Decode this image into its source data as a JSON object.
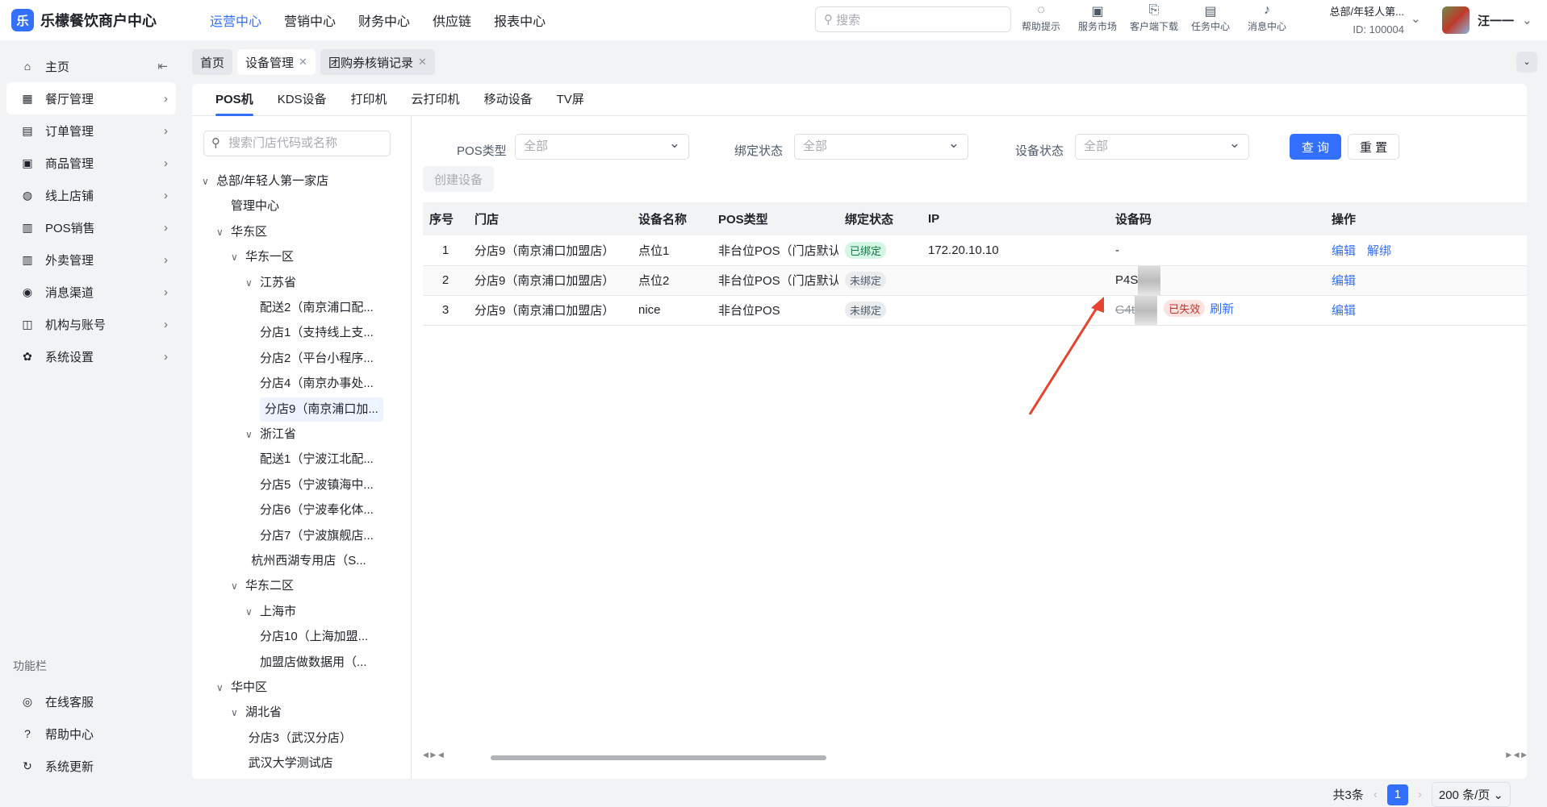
{
  "app": {
    "title": "乐檬餐饮商户中心",
    "logo_letter": "乐"
  },
  "nav": [
    "运营中心",
    "营销中心",
    "财务中心",
    "供应链",
    "报表中心"
  ],
  "search": {
    "placeholder": "搜索"
  },
  "tools": [
    {
      "icon": "lightbulb",
      "label": "帮助提示"
    },
    {
      "icon": "store-bag",
      "label": "服务市场"
    },
    {
      "icon": "download",
      "label": "客户端下载"
    },
    {
      "icon": "clipboard",
      "label": "任务中心"
    },
    {
      "icon": "bell",
      "label": "消息中心"
    }
  ],
  "org": {
    "name": "总部/年轻人第...",
    "id": "ID: 100004"
  },
  "user": {
    "name": "汪一一"
  },
  "sidebar": {
    "items": [
      {
        "icon": "⌂",
        "label": "主页"
      },
      {
        "icon": "▦",
        "label": "餐厅管理"
      },
      {
        "icon": "▤",
        "label": "订单管理"
      },
      {
        "icon": "▣",
        "label": "商品管理"
      },
      {
        "icon": "◍",
        "label": "线上店铺"
      },
      {
        "icon": "▥",
        "label": "POS销售"
      },
      {
        "icon": "▥",
        "label": "外卖管理"
      },
      {
        "icon": "◉",
        "label": "消息渠道"
      },
      {
        "icon": "◫",
        "label": "机构与账号"
      },
      {
        "icon": "✿",
        "label": "系统设置"
      }
    ],
    "func_label": "功能栏",
    "bottom": [
      {
        "icon": "◎",
        "label": "在线客服"
      },
      {
        "icon": "?",
        "label": "帮助中心"
      },
      {
        "icon": "↻",
        "label": "系统更新"
      }
    ]
  },
  "tabs": [
    {
      "label": "首页"
    },
    {
      "label": "设备管理"
    },
    {
      "label": "团购券核销记录"
    }
  ],
  "subtabs": [
    "POS机",
    "KDS设备",
    "打印机",
    "云打印机",
    "移动设备",
    "TV屏"
  ],
  "tree": {
    "search_placeholder": "搜索门店代码或名称",
    "nodes": [
      {
        "label": "总部/年轻人第一家店",
        "lvl": 0,
        "arrow": true
      },
      {
        "label": "管理中心",
        "lvl": 1,
        "arrow": false
      },
      {
        "label": "华东区",
        "lvl": 1,
        "arrow": true
      },
      {
        "label": "华东一区",
        "lvl": 2,
        "arrow": true
      },
      {
        "label": "江苏省",
        "lvl": 3,
        "arrow": true
      },
      {
        "label": "配送2（南京浦口配...",
        "lvl": 4
      },
      {
        "label": "分店1（支持线上支...",
        "lvl": 4
      },
      {
        "label": "分店2（平台小程序...",
        "lvl": 4
      },
      {
        "label": "分店4（南京办事处...",
        "lvl": 4
      },
      {
        "label": "分店9（南京浦口加...",
        "lvl": 4,
        "selected": true
      },
      {
        "label": "浙江省",
        "lvl": 3,
        "arrow": true
      },
      {
        "label": "配送1（宁波江北配...",
        "lvl": 4
      },
      {
        "label": "分店5（宁波镇海中...",
        "lvl": 4
      },
      {
        "label": "分店6（宁波奉化体...",
        "lvl": 4
      },
      {
        "label": "分店7（宁波旗舰店...",
        "lvl": 4
      },
      {
        "label": "杭州西湖专用店（S...",
        "lvl": 3.4
      },
      {
        "label": "华东二区",
        "lvl": 2,
        "arrow": true
      },
      {
        "label": "上海市",
        "lvl": 3,
        "arrow": true
      },
      {
        "label": "分店10（上海加盟...",
        "lvl": 4
      },
      {
        "label": "加盟店做数据用（...",
        "lvl": 4
      },
      {
        "label": "华中区",
        "lvl": 1,
        "arrow": true
      },
      {
        "label": "湖北省",
        "lvl": 2,
        "arrow": true
      },
      {
        "label": "分店3（武汉分店）",
        "lvl": 3.2
      },
      {
        "label": "武汉大学测试店",
        "lvl": 3.2
      }
    ]
  },
  "filters": {
    "pos_type_label": "POS类型",
    "pos_type_value": "全部",
    "bind_label": "绑定状态",
    "bind_value": "全部",
    "status_label": "设备状态",
    "status_value": "全部",
    "query": "查 询",
    "reset": "重 置",
    "create": "创建设备"
  },
  "table": {
    "headers": [
      "序号",
      "门店",
      "设备名称",
      "POS类型",
      "绑定状态",
      "IP",
      "设备码",
      "操作"
    ],
    "rows": [
      {
        "no": "1",
        "store": "分店9（南京浦口加盟店）",
        "name": "点位1",
        "type": "非台位POS（门店默认",
        "bind": "已绑定",
        "ip": "172.20.10.10",
        "code": "-",
        "expired": "",
        "refresh": "",
        "ops": [
          "编辑",
          "解绑"
        ]
      },
      {
        "no": "2",
        "store": "分店9（南京浦口加盟店）",
        "name": "点位2",
        "type": "非台位POS（门店默认",
        "bind": "未绑定",
        "ip": "",
        "code": "P4S",
        "expired": "",
        "refresh": "",
        "ops": [
          "编辑"
        ]
      },
      {
        "no": "3",
        "store": "分店9（南京浦口加盟店）",
        "name": "nice",
        "type": "非台位POS",
        "bind": "未绑定",
        "ip": "",
        "code": "G4t",
        "expired": "已失效",
        "refresh": "刷新",
        "ops": [
          "编辑"
        ]
      }
    ]
  },
  "pagination": {
    "total": "共3条",
    "page": "1",
    "size": "200 条/页"
  },
  "colors": {
    "accent": "#3370ff",
    "annotation": "#e8432e"
  }
}
